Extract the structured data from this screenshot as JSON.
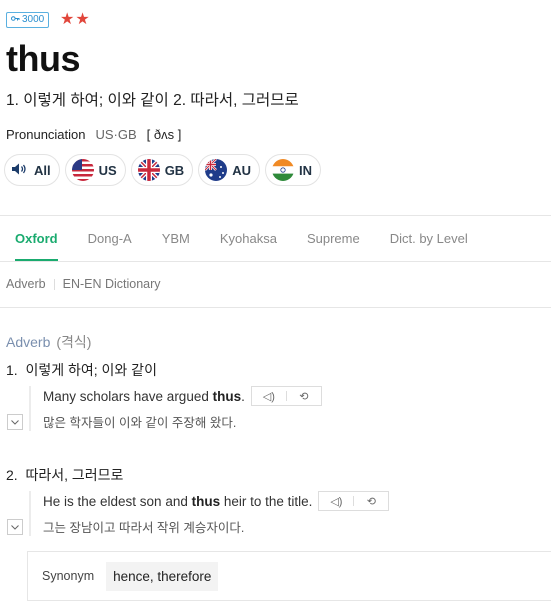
{
  "header": {
    "badge": "3000",
    "badge_icon": "key-icon",
    "stars": "★★",
    "word": "thus",
    "summary": "1. 이렇게 하여; 이와 같이 2. 따라서, 그러므로"
  },
  "pronunciation": {
    "label": "Pronunciation",
    "region": "US·GB",
    "ipa": "[ ðʌs ]"
  },
  "accents": [
    {
      "label": "All",
      "icon": "speaker-icon"
    },
    {
      "label": "US",
      "icon": "us-flag-icon"
    },
    {
      "label": "GB",
      "icon": "uk-flag-icon"
    },
    {
      "label": "AU",
      "icon": "au-flag-icon"
    },
    {
      "label": "IN",
      "icon": "in-flag-icon"
    }
  ],
  "tabs": [
    {
      "label": "Oxford",
      "active": true
    },
    {
      "label": "Dong-A"
    },
    {
      "label": "YBM"
    },
    {
      "label": "Kyohaksa"
    },
    {
      "label": "Supreme"
    },
    {
      "label": "Dict. by Level"
    }
  ],
  "subnav": {
    "pos": "Adverb",
    "dict": "EN-EN Dictionary"
  },
  "entry": {
    "pos": "Adverb",
    "hanja": "(격식)",
    "senses": [
      {
        "number": "1.",
        "meaning": "이렇게 하여; 이와 같이",
        "example_pre": "Many scholars have argued ",
        "example_bold": "thus",
        "example_post": ".",
        "translation": "많은 학자들이 이와 같이 주장해 왔다."
      },
      {
        "number": "2.",
        "meaning": "따라서, 그러므로",
        "example_pre": "He is the eldest son and ",
        "example_bold": "thus",
        "example_post": " heir to the title.",
        "translation": "그는 장남이고 따라서 작위 계승자이다."
      }
    ],
    "synonym_label": "Synonym",
    "synonyms": "hence, therefore"
  },
  "colors": {
    "accent": "#1aab6f",
    "star": "#e1463b",
    "pos": "#7a8fae"
  }
}
